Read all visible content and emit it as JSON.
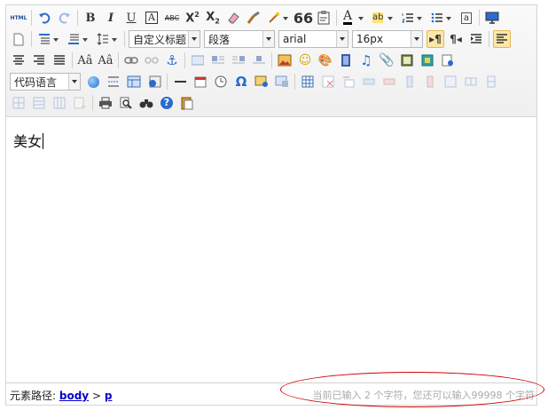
{
  "toolbar": {
    "html_label": "HTML",
    "heading_combo": "自定义标题",
    "paragraph_combo": "段落",
    "font_combo": "arial",
    "size_combo": "16px",
    "code_combo": "代码语言",
    "accent_active": "#fde7a6"
  },
  "content": {
    "text": "美女"
  },
  "statusbar": {
    "path_label": "元素路径:",
    "path_items": [
      "body",
      "p"
    ],
    "path_separator": ">",
    "count_text": "当前已输入 2 个字符，您还可以输入99998 个字符"
  },
  "annotation": {
    "color": "#cc0000"
  }
}
